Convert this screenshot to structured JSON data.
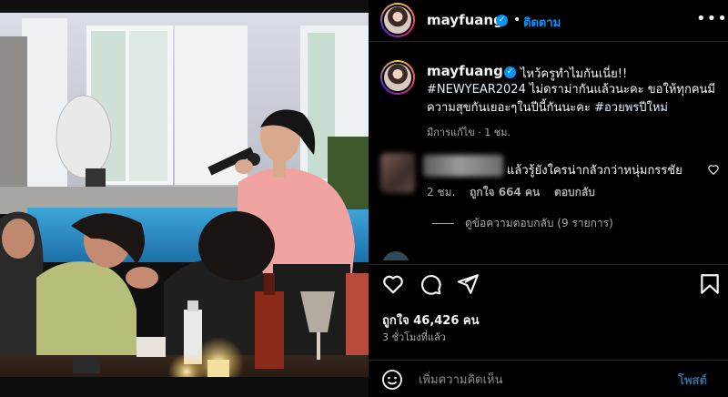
{
  "post": {
    "username": "mayfuang",
    "follow_label": "ติดตาม",
    "more_icon": "more-horizontal-icon",
    "verified_icon": "verified-badge-icon"
  },
  "caption": {
    "first_line": "ไหว้ครูทำไมกันเนี่ย!!",
    "hashtag_newyear": "#NEWYEAR2024",
    "body": " ไม่ดราม่ากันแล้วนะคะ ขอให้ทุกคนมีความสุขกันเยอะๆในปีนี้กันนะคะ ",
    "hashtag_blessing": "#อวยพรปีใหม่",
    "meta": "มีการแก้ไข · 1 ชม."
  },
  "comment": {
    "text": "แล้วรู้ยังใครน่ากลัวกว่าหนุ่มกรรชัย",
    "time": "2 ชม.",
    "likes": "ถูกใจ 664 คน",
    "reply_label": "ตอบกลับ",
    "view_replies": "ดูข้อความตอบกลับ (9 รายการ)"
  },
  "footer": {
    "likes": "ถูกใจ 46,426 คน",
    "time": "3 ชั่วโมงที่แล้ว",
    "comment_placeholder": "เพิ่มความคิดเห็น",
    "post_label": "โพสต์"
  },
  "colors": {
    "background": "#000000",
    "accent_blue": "#0095f6",
    "text_primary": "#f5f5f5",
    "text_secondary": "#a8a8a8",
    "divider": "#262626"
  }
}
